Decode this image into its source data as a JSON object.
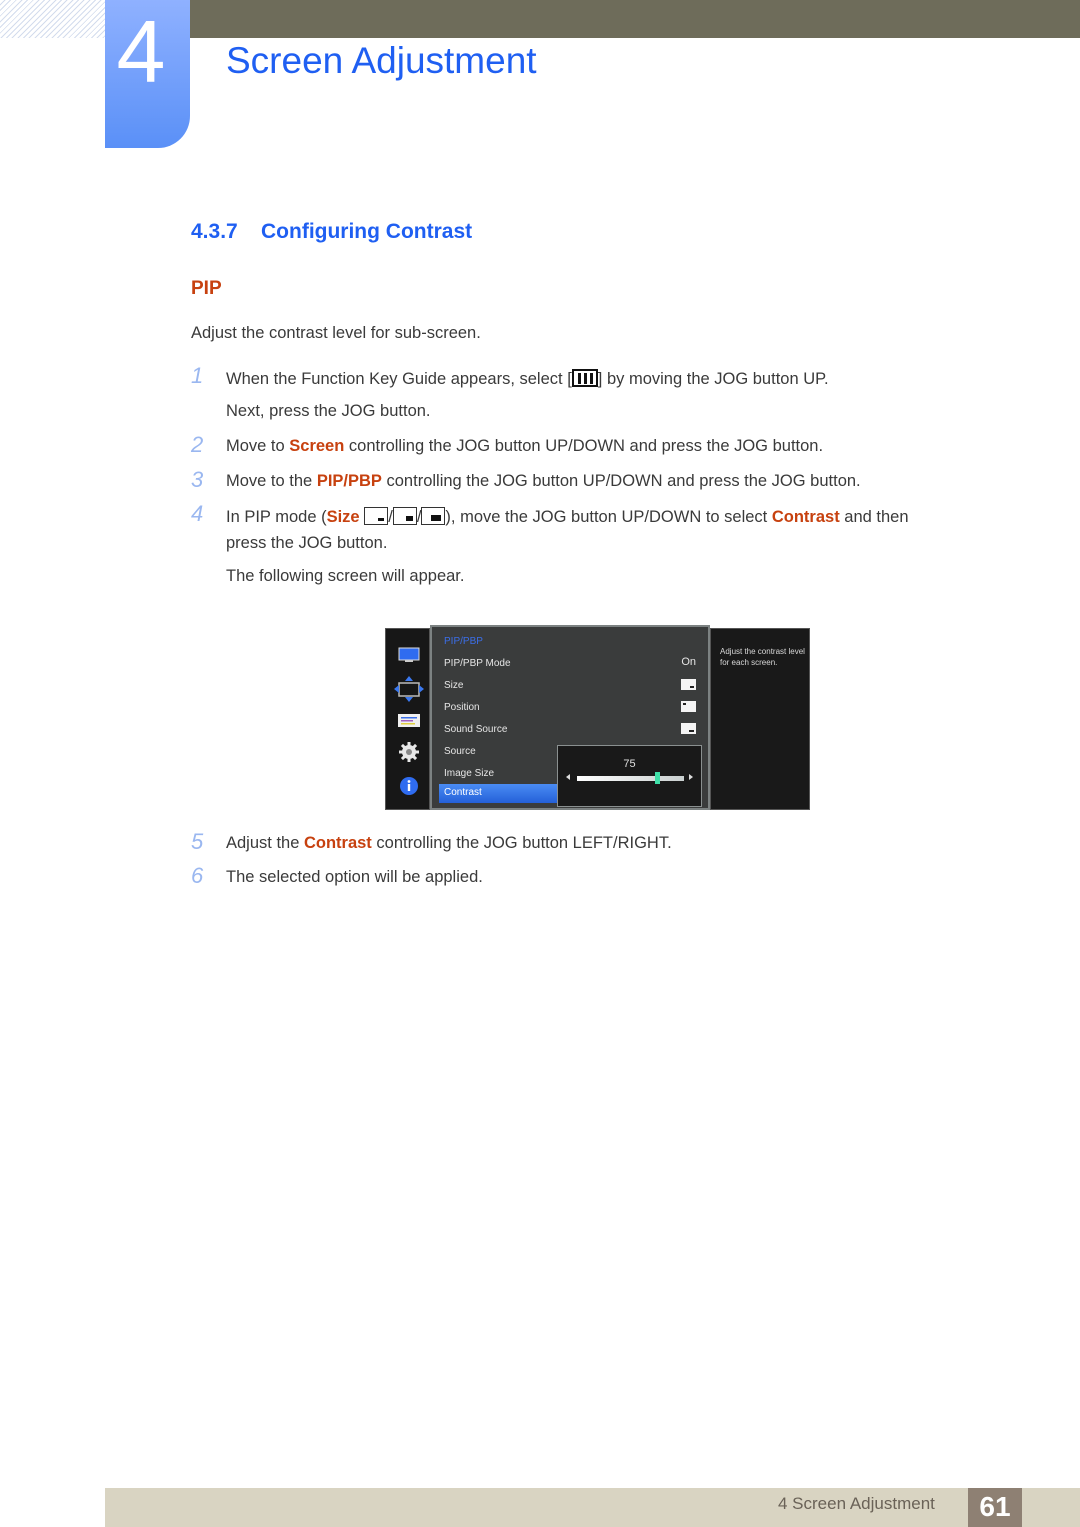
{
  "chapter": {
    "number": "4",
    "title": "Screen Adjustment"
  },
  "section": {
    "number": "4.3.7",
    "title": "Configuring Contrast"
  },
  "subsection": "PIP",
  "intro": "Adjust the contrast level for sub-screen.",
  "steps": [
    {
      "n": "1",
      "parts": [
        "When the Function Key Guide appears, select [",
        "] by moving the JOG button UP."
      ],
      "cont": "Next, press the JOG button.",
      "icon": "function-key-guide-icon"
    },
    {
      "n": "2",
      "pre": "Move to ",
      "hl": "Screen",
      "post": " controlling the JOG button UP/DOWN and press the JOG button."
    },
    {
      "n": "3",
      "pre": "Move to the ",
      "hl": "PIP/PBP",
      "post": " controlling the JOG button UP/DOWN and press the JOG button."
    },
    {
      "n": "4",
      "pre": "In PIP mode (",
      "hl": "Size",
      "mid": "), move the JOG button UP/DOWN to select ",
      "hl2": "Contrast",
      "post": " and then",
      "cont": "press the JOG button.",
      "cont2": "The following screen will appear.",
      "sep": "/"
    },
    {
      "n": "5",
      "pre": "Adjust the ",
      "hl": "Contrast",
      "post": " controlling the JOG button LEFT/RIGHT."
    },
    {
      "n": "6",
      "text": "The selected option will be applied."
    }
  ],
  "osd": {
    "header": "PIP/PBP",
    "items": [
      {
        "label": "PIP/PBP Mode",
        "value": "On"
      },
      {
        "label": "Size",
        "icon": "size-small-icon"
      },
      {
        "label": "Position",
        "icon": "position-top-left-icon"
      },
      {
        "label": "Sound Source",
        "icon": "sound-source-icon"
      },
      {
        "label": "Source"
      },
      {
        "label": "Image Size"
      },
      {
        "label": "Contrast",
        "selected": true
      }
    ],
    "slider": {
      "value": "75",
      "fraction": 0.75
    },
    "help": "Adjust the contrast level for each screen.",
    "sidebar_icons": [
      "picture-icon",
      "onscreen-display-icon",
      "setup-icon",
      "system-gear-icon",
      "information-icon"
    ]
  },
  "footer": {
    "chapter_label": "4 Screen Adjustment",
    "page": "61"
  },
  "colors": {
    "accent_blue": "#1f5ff2",
    "highlight_orange": "#c7410f",
    "step_number": "#9ab7f0"
  }
}
